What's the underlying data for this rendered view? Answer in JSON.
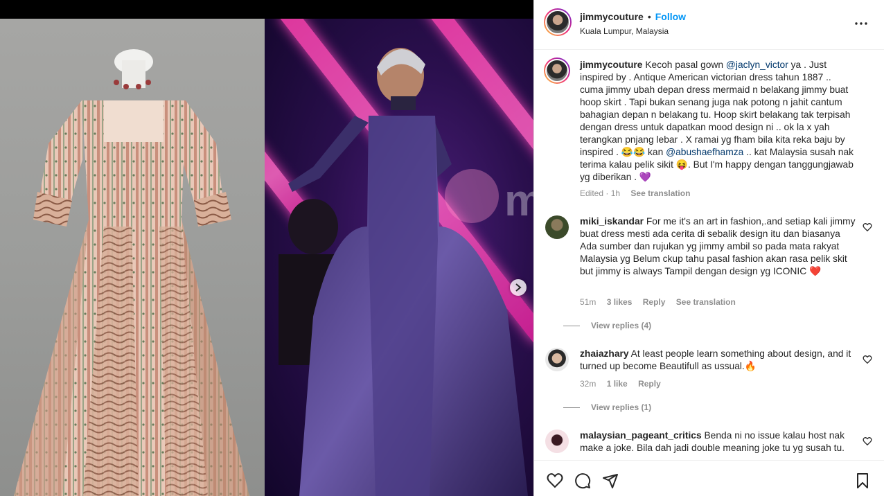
{
  "post": {
    "username": "jimmycouture",
    "follow_label": "Follow",
    "dot": "•",
    "location": "Kuala Lumpur, Malaysia"
  },
  "caption": {
    "username": "jimmycouture",
    "text_1": "Kecoh pasal gown ",
    "mention_1": "@jaclyn_victor",
    "text_2": " ya . Just inspired by . Antique American victorian dress tahun 1887 .. cuma jimmy ubah depan dress mermaid n belakang jimmy buat hoop skirt . Tapi bukan senang juga nak potong n jahit cantum bahagian depan n belakang tu. Hoop skirt belakang tak terpisah dengan dress untuk dapatkan mood design ni .. ok la x yah terangkan pnjang lebar . X ramai yg fham bila kita reka baju by inspired . ",
    "emoji_1": "😂😂",
    "text_3": " kan ",
    "mention_2": "@abushaefhamza",
    "text_4": " .. kat Malaysia susah nak terima kalau pelik sikit ",
    "emoji_2": "😝",
    "text_5": ". But I'm happy dengan tanggungjawab yg diberikan . ",
    "emoji_3": "💜",
    "edited": "Edited · 1h",
    "see_translation": "See translation"
  },
  "comments": [
    {
      "username": "miki_iskandar",
      "text": "For me it's an art in fashion,.and setiap kali jimmy buat dress mesti ada cerita di sebalik design itu dan biasanya Ada sumber dan rujukan yg jimmy ambil so pada mata rakyat Malaysia yg Belum ckup tahu pasal fashion akan rasa pelik skit but jimmy is always Tampil dengan design yg ICONIC ",
      "emoji": "❤️",
      "time": "51m",
      "likes": "3 likes",
      "reply": "Reply",
      "see_translation": "See translation",
      "view_replies": "View replies (4)"
    },
    {
      "username": "zhaiazhary",
      "text": "At least people learn something about design, and it turned up become Beautifull as ussual.",
      "emoji": "🔥",
      "time": "32m",
      "likes": "1 like",
      "reply": "Reply",
      "view_replies": "View replies (1)"
    },
    {
      "username": "malaysian_pageant_critics",
      "text": "Benda ni no issue kalau host nak make a joke. Bila dah jadi double meaning joke tu yg susah tu."
    }
  ],
  "media": {
    "watermark": "murai"
  },
  "icons": {
    "more": "more-options-icon",
    "like": "heart-icon",
    "comment": "comment-icon",
    "share": "share-icon",
    "save": "bookmark-icon",
    "next": "chevron-right-icon"
  },
  "colors": {
    "accent": "#0095f6",
    "text": "#262626",
    "muted": "#8e8e8e",
    "mention": "#00376b",
    "stage_pink": "#ff3fb0"
  }
}
